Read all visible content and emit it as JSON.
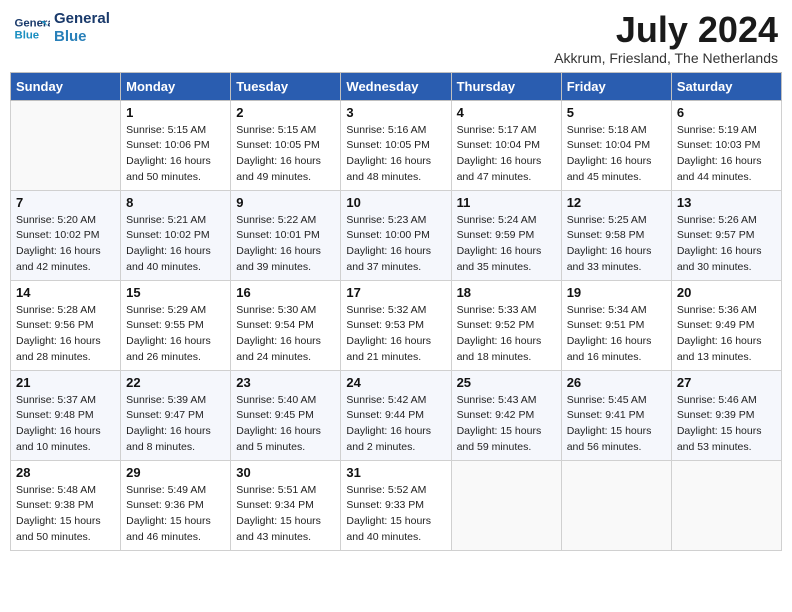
{
  "logo": {
    "line1": "General",
    "line2": "Blue"
  },
  "title": "July 2024",
  "location": "Akkrum, Friesland, The Netherlands",
  "columns": [
    "Sunday",
    "Monday",
    "Tuesday",
    "Wednesday",
    "Thursday",
    "Friday",
    "Saturday"
  ],
  "weeks": [
    [
      {
        "num": "",
        "info": ""
      },
      {
        "num": "1",
        "info": "Sunrise: 5:15 AM\nSunset: 10:06 PM\nDaylight: 16 hours\nand 50 minutes."
      },
      {
        "num": "2",
        "info": "Sunrise: 5:15 AM\nSunset: 10:05 PM\nDaylight: 16 hours\nand 49 minutes."
      },
      {
        "num": "3",
        "info": "Sunrise: 5:16 AM\nSunset: 10:05 PM\nDaylight: 16 hours\nand 48 minutes."
      },
      {
        "num": "4",
        "info": "Sunrise: 5:17 AM\nSunset: 10:04 PM\nDaylight: 16 hours\nand 47 minutes."
      },
      {
        "num": "5",
        "info": "Sunrise: 5:18 AM\nSunset: 10:04 PM\nDaylight: 16 hours\nand 45 minutes."
      },
      {
        "num": "6",
        "info": "Sunrise: 5:19 AM\nSunset: 10:03 PM\nDaylight: 16 hours\nand 44 minutes."
      }
    ],
    [
      {
        "num": "7",
        "info": "Sunrise: 5:20 AM\nSunset: 10:02 PM\nDaylight: 16 hours\nand 42 minutes."
      },
      {
        "num": "8",
        "info": "Sunrise: 5:21 AM\nSunset: 10:02 PM\nDaylight: 16 hours\nand 40 minutes."
      },
      {
        "num": "9",
        "info": "Sunrise: 5:22 AM\nSunset: 10:01 PM\nDaylight: 16 hours\nand 39 minutes."
      },
      {
        "num": "10",
        "info": "Sunrise: 5:23 AM\nSunset: 10:00 PM\nDaylight: 16 hours\nand 37 minutes."
      },
      {
        "num": "11",
        "info": "Sunrise: 5:24 AM\nSunset: 9:59 PM\nDaylight: 16 hours\nand 35 minutes."
      },
      {
        "num": "12",
        "info": "Sunrise: 5:25 AM\nSunset: 9:58 PM\nDaylight: 16 hours\nand 33 minutes."
      },
      {
        "num": "13",
        "info": "Sunrise: 5:26 AM\nSunset: 9:57 PM\nDaylight: 16 hours\nand 30 minutes."
      }
    ],
    [
      {
        "num": "14",
        "info": "Sunrise: 5:28 AM\nSunset: 9:56 PM\nDaylight: 16 hours\nand 28 minutes."
      },
      {
        "num": "15",
        "info": "Sunrise: 5:29 AM\nSunset: 9:55 PM\nDaylight: 16 hours\nand 26 minutes."
      },
      {
        "num": "16",
        "info": "Sunrise: 5:30 AM\nSunset: 9:54 PM\nDaylight: 16 hours\nand 24 minutes."
      },
      {
        "num": "17",
        "info": "Sunrise: 5:32 AM\nSunset: 9:53 PM\nDaylight: 16 hours\nand 21 minutes."
      },
      {
        "num": "18",
        "info": "Sunrise: 5:33 AM\nSunset: 9:52 PM\nDaylight: 16 hours\nand 18 minutes."
      },
      {
        "num": "19",
        "info": "Sunrise: 5:34 AM\nSunset: 9:51 PM\nDaylight: 16 hours\nand 16 minutes."
      },
      {
        "num": "20",
        "info": "Sunrise: 5:36 AM\nSunset: 9:49 PM\nDaylight: 16 hours\nand 13 minutes."
      }
    ],
    [
      {
        "num": "21",
        "info": "Sunrise: 5:37 AM\nSunset: 9:48 PM\nDaylight: 16 hours\nand 10 minutes."
      },
      {
        "num": "22",
        "info": "Sunrise: 5:39 AM\nSunset: 9:47 PM\nDaylight: 16 hours\nand 8 minutes."
      },
      {
        "num": "23",
        "info": "Sunrise: 5:40 AM\nSunset: 9:45 PM\nDaylight: 16 hours\nand 5 minutes."
      },
      {
        "num": "24",
        "info": "Sunrise: 5:42 AM\nSunset: 9:44 PM\nDaylight: 16 hours\nand 2 minutes."
      },
      {
        "num": "25",
        "info": "Sunrise: 5:43 AM\nSunset: 9:42 PM\nDaylight: 15 hours\nand 59 minutes."
      },
      {
        "num": "26",
        "info": "Sunrise: 5:45 AM\nSunset: 9:41 PM\nDaylight: 15 hours\nand 56 minutes."
      },
      {
        "num": "27",
        "info": "Sunrise: 5:46 AM\nSunset: 9:39 PM\nDaylight: 15 hours\nand 53 minutes."
      }
    ],
    [
      {
        "num": "28",
        "info": "Sunrise: 5:48 AM\nSunset: 9:38 PM\nDaylight: 15 hours\nand 50 minutes."
      },
      {
        "num": "29",
        "info": "Sunrise: 5:49 AM\nSunset: 9:36 PM\nDaylight: 15 hours\nand 46 minutes."
      },
      {
        "num": "30",
        "info": "Sunrise: 5:51 AM\nSunset: 9:34 PM\nDaylight: 15 hours\nand 43 minutes."
      },
      {
        "num": "31",
        "info": "Sunrise: 5:52 AM\nSunset: 9:33 PM\nDaylight: 15 hours\nand 40 minutes."
      },
      {
        "num": "",
        "info": ""
      },
      {
        "num": "",
        "info": ""
      },
      {
        "num": "",
        "info": ""
      }
    ]
  ]
}
